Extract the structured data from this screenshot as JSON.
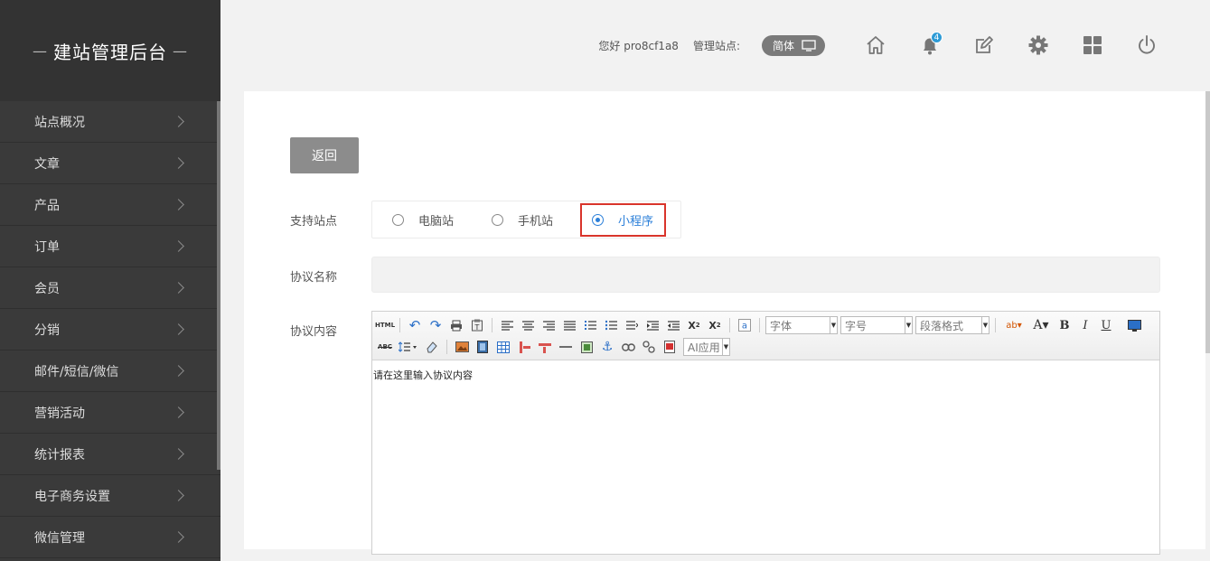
{
  "sidebar": {
    "brand": "建站管理后台",
    "brand_dash": "—",
    "items": [
      {
        "label": "站点概况"
      },
      {
        "label": "文章"
      },
      {
        "label": "产品"
      },
      {
        "label": "订单"
      },
      {
        "label": "会员"
      },
      {
        "label": "分销"
      },
      {
        "label": "邮件/短信/微信"
      },
      {
        "label": "营销活动"
      },
      {
        "label": "统计报表"
      },
      {
        "label": "电子商务设置"
      },
      {
        "label": "微信管理"
      }
    ]
  },
  "header": {
    "greeting": "您好 pro8cf1a8",
    "site_label": "管理站点:",
    "lang": "简体",
    "notification_count": "4",
    "icons": [
      "home-icon",
      "bell-icon",
      "edit-icon",
      "gear-icon",
      "grid-icon",
      "power-icon"
    ]
  },
  "form": {
    "back_label": "返回",
    "site_support_label": "支持站点",
    "options": [
      {
        "label": "电脑站",
        "checked": false
      },
      {
        "label": "手机站",
        "checked": false
      },
      {
        "label": "小程序",
        "checked": true
      }
    ],
    "name_label": "协议名称",
    "name_value": "",
    "content_label": "协议内容",
    "content_placeholder": "请在这里输入协议内容"
  },
  "editor": {
    "html_label": "HTML",
    "font_combo": "字体",
    "size_combo": "字号",
    "paragraph_combo": "段落格式",
    "ai_combo": "AI应用",
    "abc_label": "ABC"
  },
  "colors": {
    "sidebar_bg": "#3a3a3a",
    "accent_blue": "#2b7fd9",
    "highlight_red": "#d9342b",
    "badge_blue": "#2e9bd6"
  }
}
